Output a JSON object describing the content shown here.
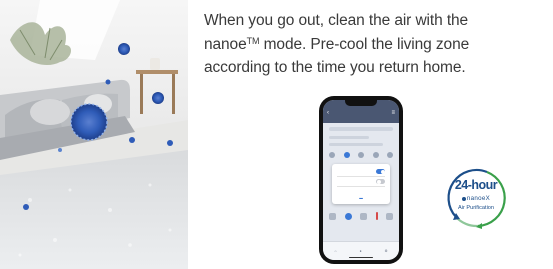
{
  "description": {
    "line1": "When you go out, clean the air with the",
    "line2_pre": "nanoe",
    "line2_tm": "TM",
    "line2_post": " mode. Pre-cool the living zone",
    "line3": "according to the time you return home."
  },
  "badge": {
    "hours": "24-hour",
    "logo": "nanoeX",
    "subtitle": "Air Purification"
  },
  "colors": {
    "text": "#3a3a3a",
    "badge_blue": "#1d4f8a",
    "badge_green": "#3aa04a",
    "app_header": "#4a5772",
    "app_accent": "#3a78d6"
  }
}
